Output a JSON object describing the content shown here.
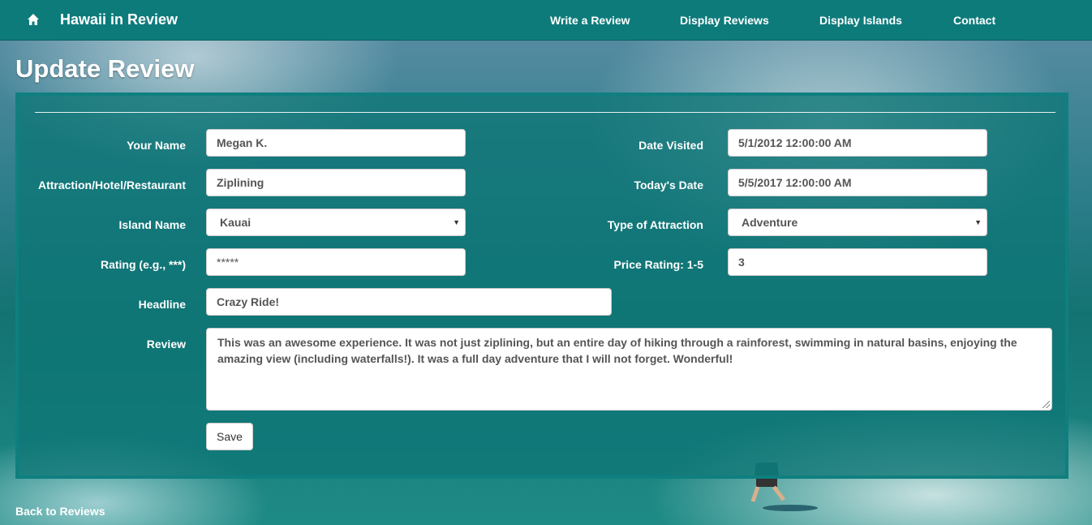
{
  "navbar": {
    "brand": "Hawaii in Review",
    "links": [
      "Write a Review",
      "Display Reviews",
      "Display Islands",
      "Contact"
    ]
  },
  "page": {
    "title": "Update Review"
  },
  "form": {
    "your_name": {
      "label": "Your Name",
      "value": "Megan K."
    },
    "attraction": {
      "label": "Attraction/Hotel/Restaurant",
      "value": "Ziplining"
    },
    "island": {
      "label": "Island Name",
      "value": "Kauai"
    },
    "rating": {
      "label": "Rating (e.g., ***)",
      "value": "*****"
    },
    "headline": {
      "label": "Headline",
      "value": "Crazy Ride!"
    },
    "review": {
      "label": "Review",
      "value": "This was an awesome experience.  It was not just ziplining, but an entire day of hiking through a rainforest, swimming in natural basins, enjoying the amazing view (including waterfalls!).  It was a full day adventure that I will not forget.  Wonderful!"
    },
    "date_visited": {
      "label": "Date Visited",
      "value": "5/1/2012 12:00:00 AM"
    },
    "todays_date": {
      "label": "Today's Date",
      "value": "5/5/2017 12:00:00 AM"
    },
    "attraction_type": {
      "label": "Type of Attraction",
      "value": "Adventure"
    },
    "price_rating": {
      "label": "Price Rating: 1-5",
      "value": "3"
    },
    "save_label": "Save"
  },
  "footer": {
    "back_label": "Back to Reviews"
  },
  "colors": {
    "navbar": "#0e7b7b",
    "panel": "#0f7f7f"
  }
}
